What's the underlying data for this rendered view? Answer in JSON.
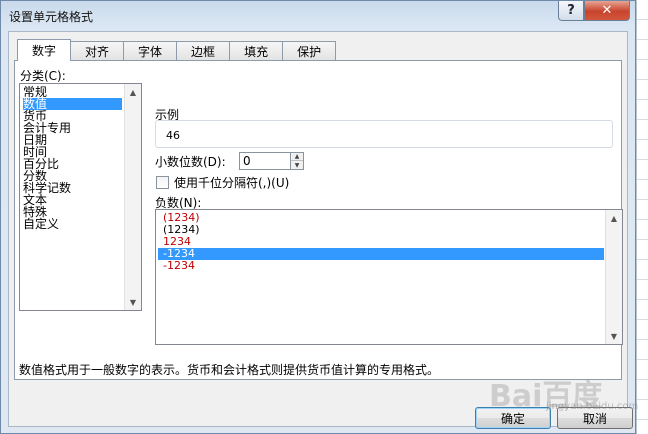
{
  "window": {
    "title": "设置单元格格式",
    "help_glyph": "?",
    "close_glyph": "✕"
  },
  "tabs": [
    {
      "label": "数字",
      "active": true
    },
    {
      "label": "对齐",
      "active": false
    },
    {
      "label": "字体",
      "active": false
    },
    {
      "label": "边框",
      "active": false
    },
    {
      "label": "填充",
      "active": false
    },
    {
      "label": "保护",
      "active": false
    }
  ],
  "category": {
    "label": "分类(C):",
    "items": [
      "常规",
      "数值",
      "货币",
      "会计专用",
      "日期",
      "时间",
      "百分比",
      "分数",
      "科学记数",
      "文本",
      "特殊",
      "自定义"
    ],
    "selected": "数值"
  },
  "sample": {
    "label": "示例",
    "value": "46"
  },
  "decimal_places": {
    "label": "小数位数(D):",
    "value": "0"
  },
  "thousands_separator": {
    "label": "使用千位分隔符(,)(U)",
    "checked": false
  },
  "negative_numbers": {
    "label": "负数(N):",
    "items": [
      {
        "text": "(1234)",
        "color": "#c00000"
      },
      {
        "text": "(1234)",
        "color": "#000000"
      },
      {
        "text": "1234",
        "color": "#c00000"
      },
      {
        "text": "-1234",
        "color": "#000000",
        "selected": true
      },
      {
        "text": "-1234",
        "color": "#c00000"
      }
    ]
  },
  "description": "数值格式用于一般数字的表示。货币和会计格式则提供货币值计算的专用格式。",
  "buttons": {
    "ok": "确定",
    "cancel": "取消"
  },
  "watermark": {
    "text": "Bai百度",
    "sub": "jingyan.baidu.com"
  },
  "colors": {
    "selection": "#3399ff",
    "negative_red": "#c00000"
  }
}
